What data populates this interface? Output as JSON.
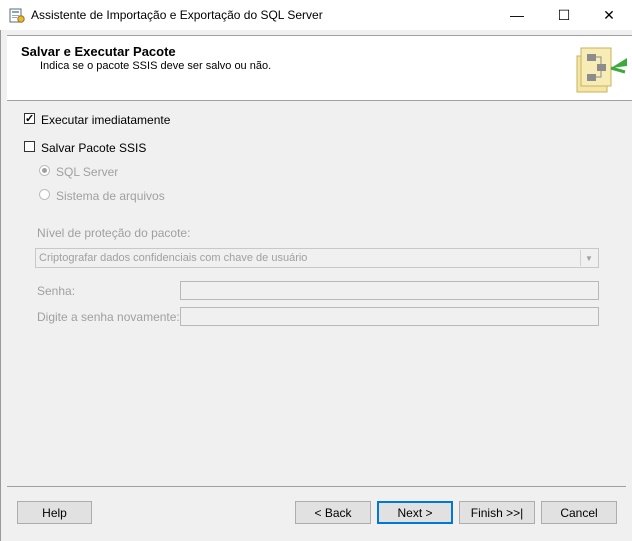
{
  "window": {
    "title": "Assistente de Importação e Exportação do SQL Server",
    "minimize_glyph": "—",
    "maximize_glyph": "☐",
    "close_glyph": "✕"
  },
  "header": {
    "title": "Salvar e Executar Pacote",
    "subtitle": "Indica se o pacote SSIS deve ser salvo ou não."
  },
  "options": {
    "run_now": {
      "label": "Executar imediatamente",
      "checked": true
    },
    "save_package": {
      "label": "Salvar Pacote SSIS",
      "checked": false
    },
    "sql_server": {
      "label": "SQL Server",
      "selected": true
    },
    "file_system": {
      "label": "Sistema de arquivos",
      "selected": false
    }
  },
  "protection": {
    "label": "Nível de proteção do pacote:",
    "selected_value": "Criptografar dados confidenciais com chave de usuário",
    "dropdown_glyph": "▼"
  },
  "password": {
    "label": "Senha:",
    "value": ""
  },
  "password_confirm": {
    "label": "Digite a senha novamente:",
    "value": ""
  },
  "buttons": {
    "help": "Help",
    "back": "< Back",
    "next": "Next >",
    "finish": "Finish >>|",
    "cancel": "Cancel"
  },
  "icons": {
    "app": "wizard-app-icon",
    "header": "package-flow-icon"
  },
  "colors": {
    "accent": "#0078d7",
    "disabled_text": "#a0a0a0",
    "header_bg": "#ffffff",
    "window_bg": "#f0f0f0"
  }
}
